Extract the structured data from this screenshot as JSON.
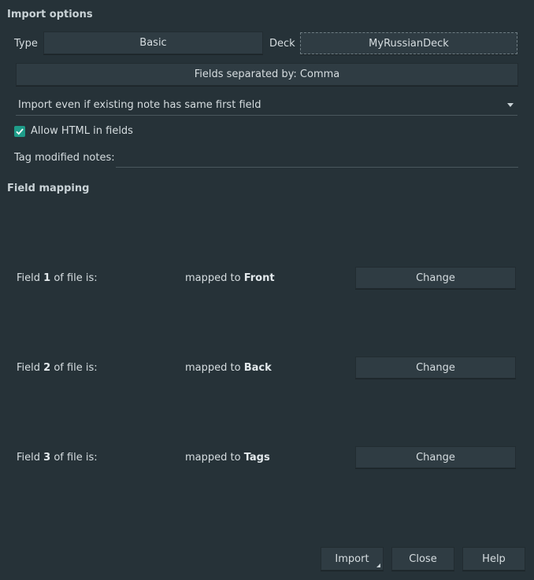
{
  "import_options": {
    "heading": "Import options",
    "type_label": "Type",
    "type_value": "Basic",
    "deck_label": "Deck",
    "deck_value": "MyRussianDeck",
    "separator_button": "Fields separated by: Comma",
    "duplicate_mode": "Import even if existing note has same first field",
    "allow_html_label": "Allow HTML in fields",
    "allow_html_checked": true,
    "tag_modified_label": "Tag modified notes:",
    "tag_modified_value": ""
  },
  "field_mapping": {
    "heading": "Field mapping",
    "rows": [
      {
        "prefix": "Field ",
        "num": "1",
        "suffix": " of file is:",
        "mapped_prefix": "mapped to ",
        "target": "Front",
        "change_label": "Change"
      },
      {
        "prefix": "Field ",
        "num": "2",
        "suffix": " of file is:",
        "mapped_prefix": "mapped to ",
        "target": "Back",
        "change_label": "Change"
      },
      {
        "prefix": "Field ",
        "num": "3",
        "suffix": " of file is:",
        "mapped_prefix": "mapped to ",
        "target": "Tags",
        "change_label": "Change"
      }
    ]
  },
  "footer": {
    "import_label": "Import",
    "close_label": "Close",
    "help_label": "Help"
  },
  "colors": {
    "background": "#263238",
    "button": "#2f3c43",
    "accent": "#1e9c89"
  },
  "icons": {
    "checkbox": "check-icon",
    "dropdown": "chevron-down-icon",
    "menu_indicator": "corner-triangle-icon"
  }
}
